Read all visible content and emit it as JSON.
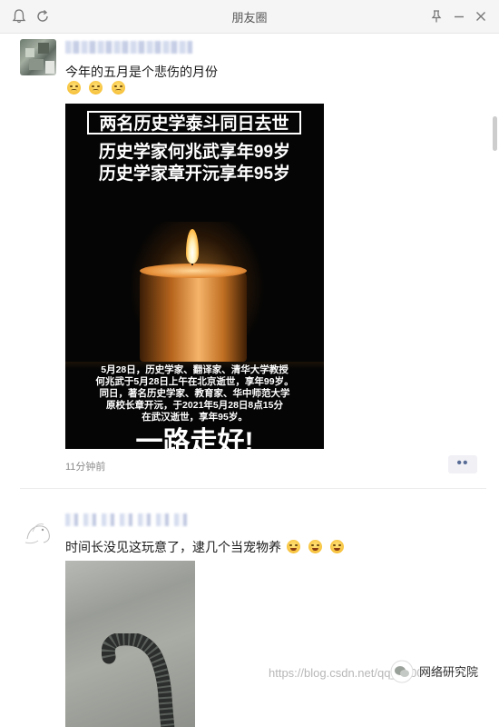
{
  "window": {
    "title": "朋友圈",
    "icons": {
      "left": [
        "bell-icon",
        "refresh-icon"
      ],
      "right": [
        "pin-icon",
        "minimize-icon",
        "close-icon"
      ]
    }
  },
  "posts": [
    {
      "text": "今年的五月是个悲伤的月份",
      "emojis": [
        "sad-face-icon",
        "sad-face-icon",
        "sad-face-icon"
      ],
      "image": {
        "headline": "两名历史学泰斗同日去世",
        "line1": "历史学家何兆武享年99岁",
        "line2": "历史学家章开沅享年95岁",
        "caption": [
          "5月28日，历史学家、翻译家、清华大学教授",
          "何兆武于5月28日上午在北京逝世，享年99岁。",
          "同日，著名历史学家、教育家、华中师范大学",
          "原校长章开沅，于2021年5月28日8点15分",
          "在武汉逝世，享年95岁。"
        ],
        "bottom_text": "一路走好!"
      },
      "time": "11分钟前",
      "more_label": "••"
    },
    {
      "text": "时间长没见这玩意了，逮几个当宠物养",
      "emojis": [
        "laughing-tears-icon",
        "laughing-tears-icon",
        "laughing-tears-icon"
      ]
    }
  ],
  "watermark": {
    "url": "https://blog.csdn.net/qq_35007037",
    "account": "网络研究院"
  }
}
